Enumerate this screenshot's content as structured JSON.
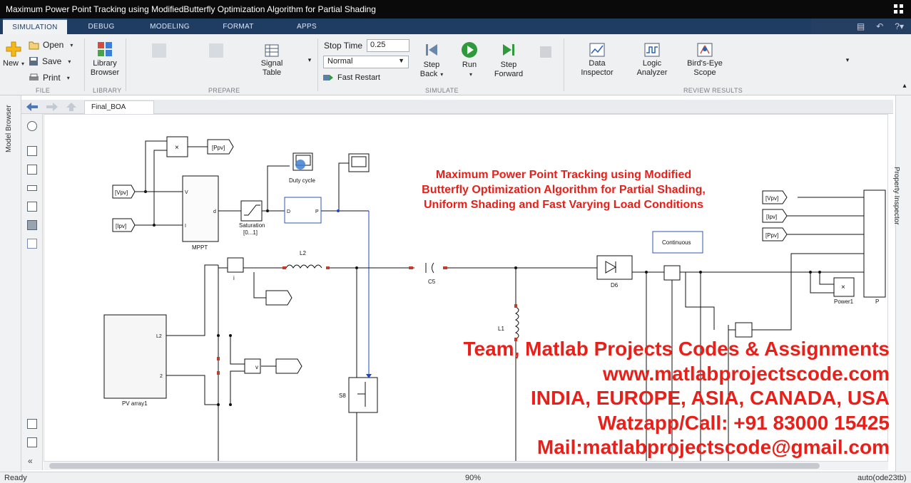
{
  "window": {
    "title": "Maximum Power Point Tracking using ModifiedButterfly Optimization Algorithm for Partial Shading"
  },
  "tabs": [
    "SIMULATION",
    "DEBUG",
    "MODELING",
    "FORMAT",
    "APPS"
  ],
  "ribbon": {
    "file": {
      "label": "FILE",
      "new": "New",
      "open": "Open",
      "save": "Save",
      "print": "Print"
    },
    "library": {
      "label": "LIBRARY",
      "browser_line1": "Library",
      "browser_line2": "Browser"
    },
    "prepare": {
      "label": "PREPARE",
      "signal_table_line1": "Signal",
      "signal_table_line2": "Table"
    },
    "simulate": {
      "label": "SIMULATE",
      "stop_time_label": "Stop Time",
      "stop_time_value": "0.25",
      "mode": "Normal",
      "fast_restart": "Fast Restart",
      "step_back_line1": "Step",
      "step_back_line2": "Back",
      "run": "Run",
      "step_forward_line1": "Step",
      "step_forward_line2": "Forward"
    },
    "review": {
      "label": "REVIEW RESULTS",
      "data_inspector_line1": "Data",
      "data_inspector_line2": "Inspector",
      "logic_analyzer_line1": "Logic",
      "logic_analyzer_line2": "Analyzer",
      "birds_eye_line1": "Bird's-Eye",
      "birds_eye_line2": "Scope"
    }
  },
  "side": {
    "model_browser": "Model Browser",
    "property_inspector": "Property Inspector"
  },
  "explorer": {
    "model_tab": "Final_BOA"
  },
  "diagram": {
    "mult_sign": "×",
    "ppv_tag": "[Ppv]",
    "vpv_tag": "[Vpv]",
    "ipv_tag": "[Ipv]",
    "mppt_in_v": "V",
    "mppt_in_i": "I",
    "mppt_out_d": "d",
    "mppt": "MPPT",
    "saturation_line1": "Saturation",
    "saturation_line2": "[0...1]",
    "pwm_in": "D",
    "pwm_out": "P",
    "duty_cycle": "Duty cycle",
    "i_meas": "i",
    "inductor_l2": "L2",
    "capacitor_c5": "C5",
    "inductor_l1": "L1",
    "pv_array": "PV array1",
    "pv_port_l2": "L2",
    "pv_port_2": "2",
    "v_meas": "v",
    "switch_s8": "S8",
    "diode_d6": "D6",
    "continuous": "Continuous",
    "power1": "Power1",
    "ppv_goto": "[Ppv]",
    "ipv_goto": "[Ipv]",
    "vpv_goto": "[Vpv]",
    "right_p": "P"
  },
  "overlay": {
    "title_line1": "Maximum Power Point Tracking using Modified",
    "title_line2": "Butterfly Optimization Algorithm for Partial Shading,",
    "title_line3": "Uniform Shading and Fast Varying Load Conditions",
    "team_line1": "Team, Matlab Projects Codes & Assignments",
    "team_line2": "www.matlabprojectscode.com",
    "team_line3": "INDIA, EUROPE, ASIA, CANADA, USA",
    "team_line4": "Watzapp/Call: +91 83000 15425",
    "team_line5": "Mail:matlabprojectscode@gmail.com"
  },
  "status": {
    "left": "Ready",
    "zoom": "90%",
    "solver": "auto(ode23tb)"
  },
  "colors": {
    "title_bg": "#0a0a0a",
    "tab_bg": "#1f3c63",
    "ribbon_bg": "#eef0f2",
    "overlay_red": "#e8201a",
    "signal_blue": "#1f44c8"
  }
}
